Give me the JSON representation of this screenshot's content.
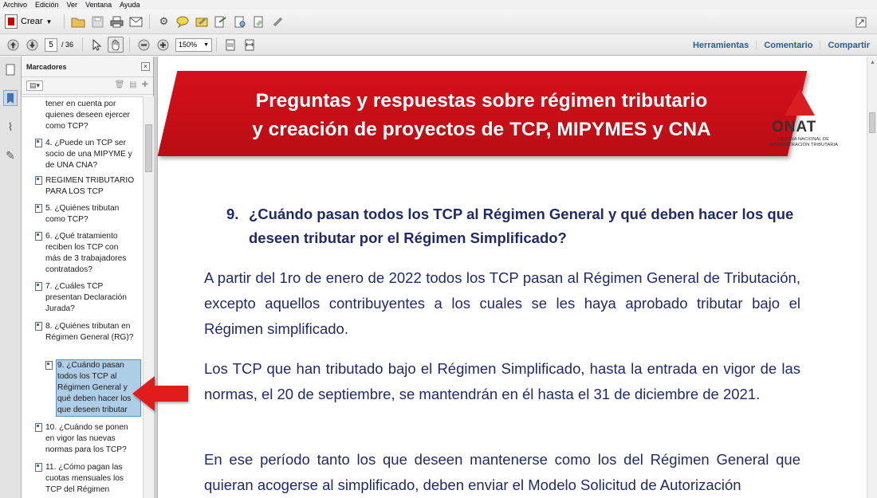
{
  "menu": [
    "Archivo",
    "Edición",
    "Ver",
    "Ventana",
    "Ayuda"
  ],
  "toolbar": {
    "crear_label": "Crear",
    "page_current": "5",
    "page_total": "/ 36",
    "zoom": "150%",
    "links": [
      "Herramientas",
      "Comentario",
      "Compartir"
    ]
  },
  "bookmarks": {
    "title": "Marcadores",
    "options_label": "▤▾",
    "items": [
      {
        "label": "tener en cuenta por quienes deseen ejercer como TCP?"
      },
      {
        "label": "4. ¿Puede un TCP ser socio de una MIPYME y de UNA CNA?"
      },
      {
        "label": "REGIMEN TRIBUTARIO PARA LOS TCP"
      },
      {
        "label": "5. ¿Quiénes tributan como TCP?"
      },
      {
        "label": "6. ¿Qué tratamiento reciben los TCP con más de 3 trabajadores contratados?"
      },
      {
        "label": "7. ¿Cuáles TCP presentan Declaración Jurada?"
      },
      {
        "label": "8. ¿Quiénes tributan en Régimen General (RG)?"
      },
      {
        "label": "9. ¿Cuándo pasan todos los TCP al Régimen General y qué deben hacer los que deseen tributar"
      },
      {
        "label": "10. ¿Cuándo se ponen en vigor las nuevas normas para los TCP?"
      },
      {
        "label": "11. ¿Cómo pagan las cuotas mensuales los TCP del Régimen"
      }
    ]
  },
  "document": {
    "banner_line1": "Preguntas y respuestas sobre régimen tributario",
    "banner_line2": "y creación de proyectos de TCP, MIPYMES y CNA",
    "logo_word": "ONAT",
    "logo_sub": "OFICINA NACIONAL DE ADMINISTRACIÓN TRIBUTARIA",
    "question_num": "9.",
    "question_text": "¿Cuándo pasan todos los TCP al Régimen General y qué deben hacer los que deseen tributar por el Régimen Simplificado?",
    "para1": "A partir del 1ro de enero de 2022 todos los TCP pasan al Régimen General de Tributación, excepto aquellos contribuyentes a los cuales se les haya aprobado tributar bajo el Régimen simplificado.",
    "para2": "Los TCP que han tributado bajo el Régimen Simplificado, hasta la entrada en vigor de las normas, el   20 de septiembre, se mantendrán en él hasta el 31 de diciembre de 2021.",
    "para3": "En ese período tanto los que deseen mantenerse como los del Régimen General que quieran acogerse al simplificado, deben enviar el Modelo Solicitud de Autorización"
  }
}
